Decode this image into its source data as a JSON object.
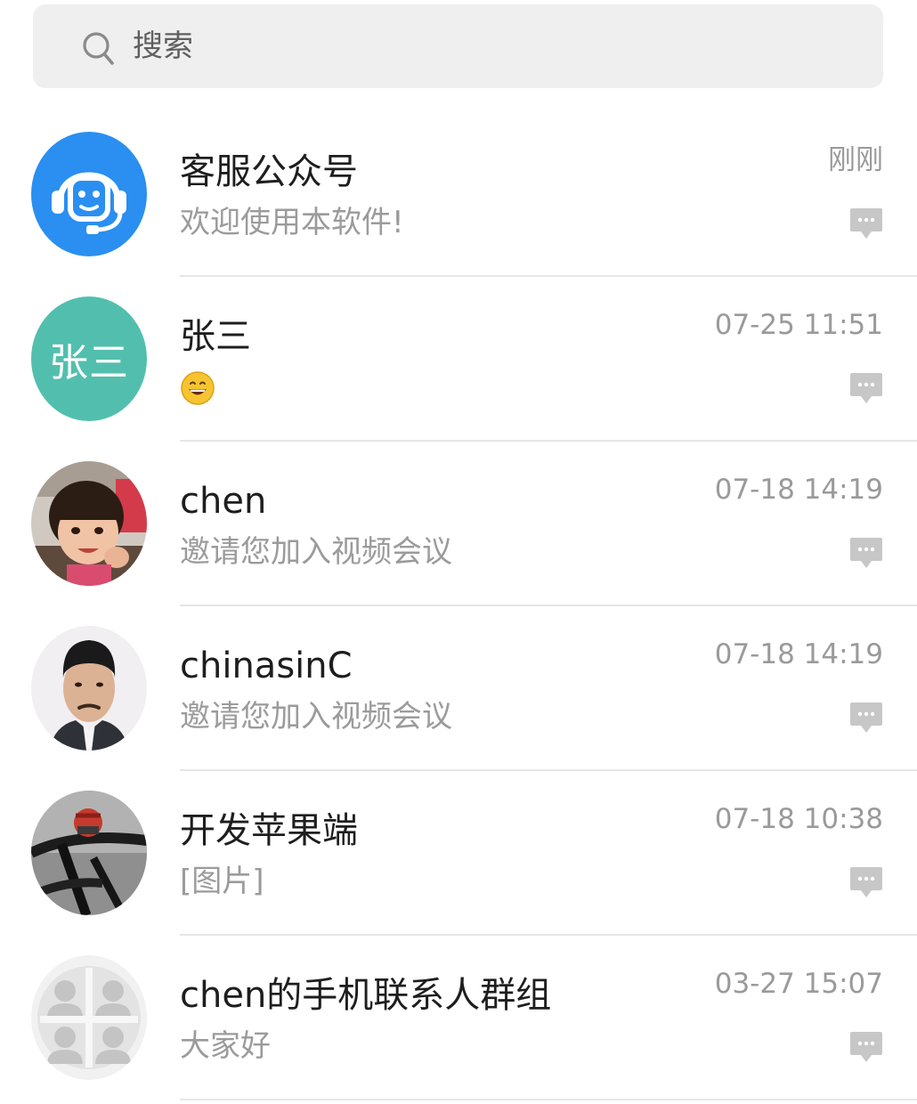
{
  "search": {
    "placeholder": "搜索"
  },
  "conversations": [
    {
      "name": "客服公众号",
      "preview": "欢迎使用本软件!",
      "time": "刚刚",
      "avatar": {
        "kind": "icon",
        "icon": "customer-service-headset-icon",
        "color": "#2a8ff0"
      }
    },
    {
      "name": "张三",
      "preview": "😄",
      "time": "07-25 11:51",
      "avatar": {
        "kind": "initials",
        "initials": "张三",
        "color": "#52bfae"
      }
    },
    {
      "name": "chen",
      "preview": "邀请您加入视频会议",
      "time": "07-18 14:19",
      "avatar": {
        "kind": "photo",
        "icon": "child-photo-avatar"
      }
    },
    {
      "name": "chinasinC",
      "preview": "邀请您加入视频会议",
      "time": "07-18 14:19",
      "avatar": {
        "kind": "photo",
        "icon": "man-portrait-photo-avatar"
      }
    },
    {
      "name": "开发苹果端",
      "preview": "[图片]",
      "time": "07-18 10:38",
      "avatar": {
        "kind": "photo",
        "icon": "bicycle-photo-avatar"
      }
    },
    {
      "name": "chen的手机联系人群组",
      "preview": "大家好",
      "time": "03-27 15:07",
      "avatar": {
        "kind": "icon",
        "icon": "group-members-icon",
        "color": "#e6e6e6"
      }
    }
  ],
  "colors": {
    "accent_blue": "#2a8ff0",
    "initials_teal": "#52bfae",
    "secondary_text": "#9b9b9b",
    "divider": "#e6e6e6",
    "search_bg": "#efefef"
  }
}
